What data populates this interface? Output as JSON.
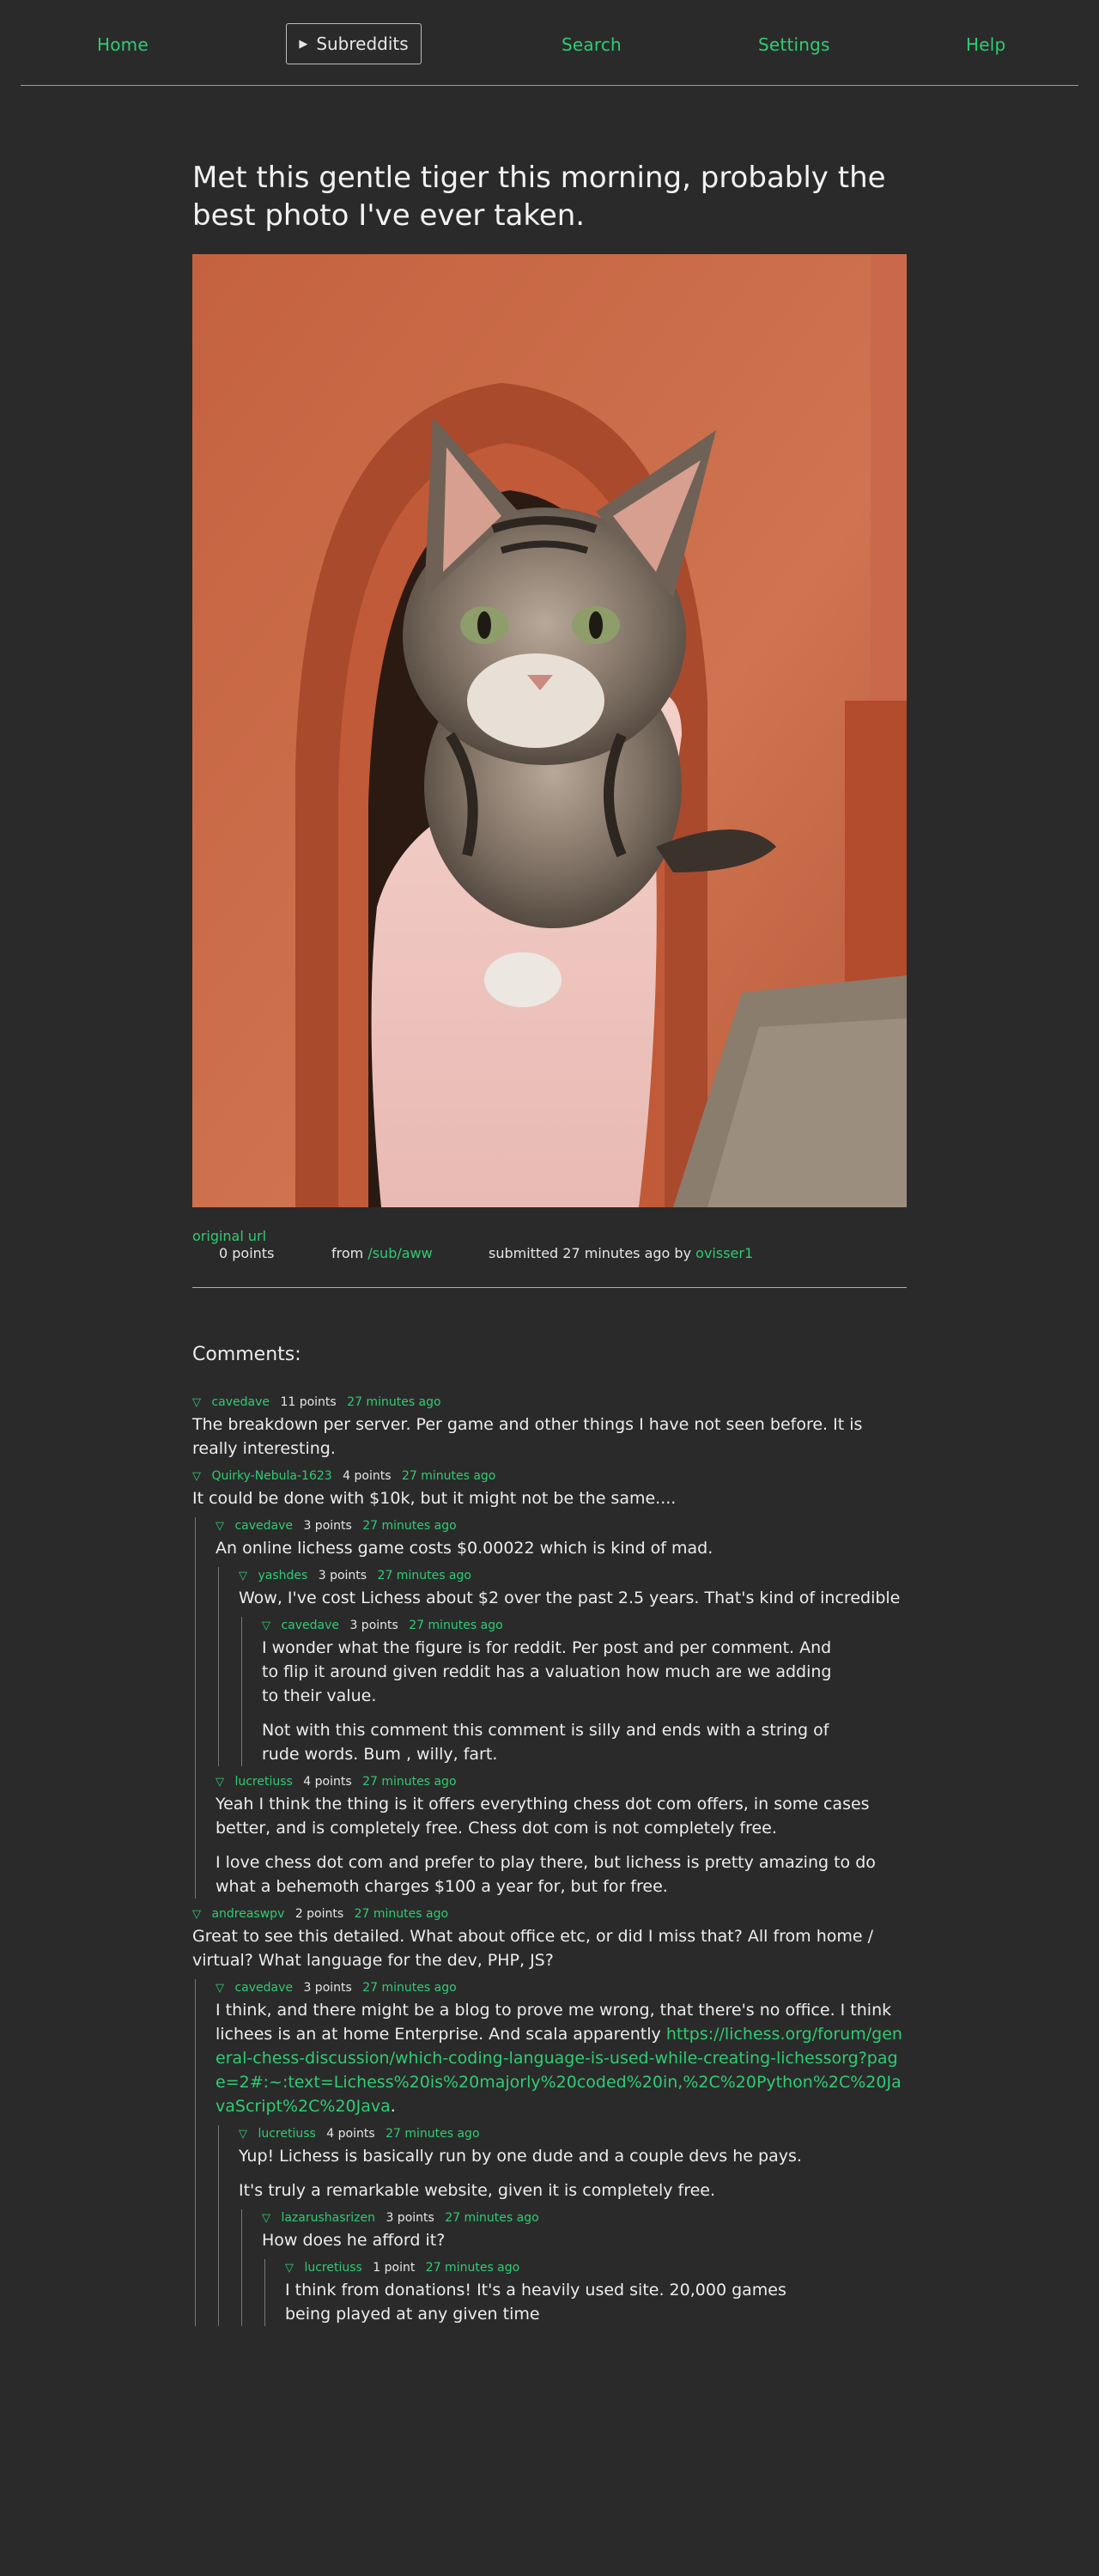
{
  "nav": {
    "home": "Home",
    "subreddits": "Subreddits",
    "search": "Search",
    "settings": "Settings",
    "help": "Help"
  },
  "post": {
    "title": "Met this gentle tiger this morning, probably the best photo I've ever taken.",
    "points": "0 points",
    "from_label": "from",
    "subreddit": "/sub/aww",
    "submitted": "submitted 27 minutes ago by",
    "author": "ovisser1",
    "original_url": "original url"
  },
  "comments_heading": "Comments:",
  "comments": {
    "c1": {
      "author": "cavedave",
      "points": "11 points",
      "time": "27 minutes ago",
      "body": "The breakdown per server. Per game and other things I have not seen before. It is really interesting."
    },
    "c2": {
      "author": "Quirky-Nebula-1623",
      "points": "4 points",
      "time": "27 minutes ago",
      "body": "It could be done with $10k, but it might not be the same...."
    },
    "c2a": {
      "author": "cavedave",
      "points": "3 points",
      "time": "27 minutes ago",
      "body": "An online lichess game costs $0.00022 which is kind of mad."
    },
    "c2a1": {
      "author": "yashdes",
      "points": "3 points",
      "time": "27 minutes ago",
      "body": "Wow, I've cost Lichess about $2 over the past 2.5 years. That's kind of incredible"
    },
    "c2a1a": {
      "author": "cavedave",
      "points": "3 points",
      "time": "27 minutes ago",
      "body1": "I wonder what the figure is for reddit. Per post and per comment. And to flip it around given reddit has a valuation how much are we adding to their value.",
      "body2": "Not with this comment this comment is silly and ends with a string of rude words. Bum , willy, fart."
    },
    "c2b": {
      "author": "lucretiuss",
      "points": "4 points",
      "time": "27 minutes ago",
      "body1": "Yeah I think the thing is it offers everything chess dot com offers, in some cases better, and is completely free. Chess dot com is not completely free.",
      "body2": "I love chess dot com and prefer to play there, but lichess is pretty amazing to do what a behemoth charges $100 a year for, but for free."
    },
    "c3": {
      "author": "andreaswpv",
      "points": "2 points",
      "time": "27 minutes ago",
      "body": "Great to see this detailed. What about office etc, or did I miss that? All from home / virtual? What language for the dev, PHP, JS?"
    },
    "c3a": {
      "author": "cavedave",
      "points": "3 points",
      "time": "27 minutes ago",
      "body": "I think, and there might be a blog to prove me wrong, that there's no office. I think lichees is an at home Enterprise. And scala apparently",
      "link": "https://lichess.org/forum/general-chess-discussion/which-coding-language-is-used-while-creating-lichessorg?page=2#:~:text=Lichess%20is%20majorly%20coded%20in,%2C%20Python%2C%20JavaScript%2C%20Java",
      "tail": "."
    },
    "c3a1": {
      "author": "lucretiuss",
      "points": "4 points",
      "time": "27 minutes ago",
      "body1": "Yup! Lichess is basically run by one dude and a couple devs he pays.",
      "body2": "It's truly a remarkable website, given it is completely free."
    },
    "c3a1a": {
      "author": "lazarushasrizen",
      "points": "3 points",
      "time": "27 minutes ago",
      "body": "How does he afford it?"
    },
    "c3a1a1": {
      "author": "lucretiuss",
      "points": "1 point",
      "time": "27 minutes ago",
      "body": "I think from donations! It's a heavily used site. 20,000 games being played at any given time"
    }
  }
}
